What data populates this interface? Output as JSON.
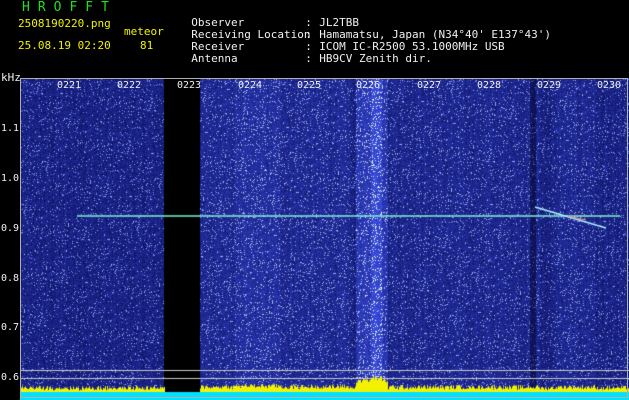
{
  "header": {
    "app_title": "HROFFT",
    "filename": "2508190220.png",
    "meteor_label": "meteor",
    "datetime": "25.08.19 02:20",
    "meteor_count": "81"
  },
  "info": [
    {
      "label": "Observer",
      "value": "JL2TBB"
    },
    {
      "label": "Receiving Location",
      "value": "Hamamatsu, Japan (N34°40' E137°43')"
    },
    {
      "label": "Receiver",
      "value": "ICOM IC-R2500 53.1000MHz USB"
    },
    {
      "label": "Antenna",
      "value": "HB9CV Zenith dir."
    }
  ],
  "axis": {
    "y_unit": "kHz",
    "y_ticks": [
      "1.1",
      "1.0",
      "0.9",
      "0.8",
      "0.7",
      "0.6"
    ],
    "x_ticks": [
      "0221",
      "0222",
      "0223",
      "0224",
      "0225",
      "0226",
      "0227",
      "0228",
      "0229",
      "0230"
    ]
  },
  "colors": {
    "background": "#1a1f8a",
    "carrier": "#7ff0d0",
    "title_green": "#22dd22",
    "label_yellow": "#f2f200"
  }
}
